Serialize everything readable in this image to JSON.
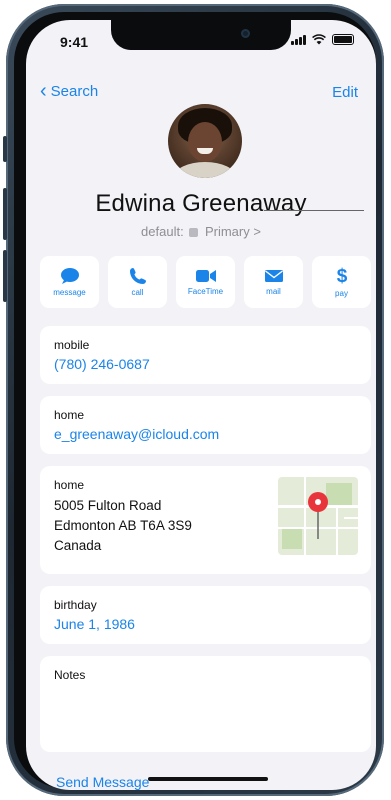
{
  "status": {
    "time": "9:41"
  },
  "nav": {
    "back_label": "Search",
    "edit_label": "Edit"
  },
  "contact": {
    "name": "Edwina Greenaway",
    "default_prefix": "default:",
    "default_value": "Primary",
    "default_chevron": ">"
  },
  "actions": [
    {
      "label": "message",
      "icon": "message-icon"
    },
    {
      "label": "call",
      "icon": "phone-icon"
    },
    {
      "label": "FaceTime",
      "icon": "video-icon"
    },
    {
      "label": "mail",
      "icon": "mail-icon"
    },
    {
      "label": "pay",
      "icon": "dollar-icon"
    }
  ],
  "fields": {
    "mobile": {
      "label": "mobile",
      "value": "(780) 246-0687"
    },
    "email": {
      "label": "home",
      "value": "e_greenaway@icloud.com"
    },
    "address": {
      "label": "home",
      "line1": "5005 Fulton Road",
      "line2": "Edmonton AB T6A 3S9",
      "line3": "Canada"
    },
    "birthday": {
      "label": "birthday",
      "value": "June 1, 1986"
    },
    "notes": {
      "label": "Notes",
      "value": ""
    }
  },
  "footer": {
    "send_message": "Send Message"
  },
  "colors": {
    "accent": "#1a84e8",
    "background": "#f2f2f7",
    "map_pin": "#e8353b"
  }
}
